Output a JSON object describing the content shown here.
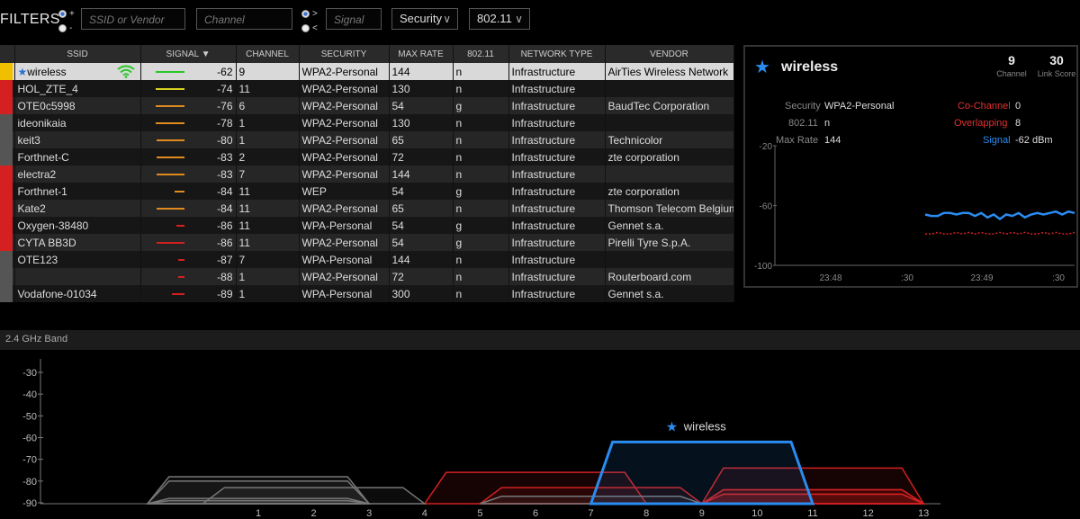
{
  "filters": {
    "title": "FILTERS",
    "plus_label": "+",
    "minus_label": "-",
    "gt_label": ">",
    "lt_label": "<",
    "ssid_placeholder": "SSID or Vendor",
    "channel_placeholder": "Channel",
    "signal_placeholder": "Signal",
    "security_label": "Security",
    "mode_label": "802.11"
  },
  "table": {
    "columns": [
      "SSID",
      "SIGNAL",
      "CHANNEL",
      "SECURITY",
      "MAX RATE",
      "802.11",
      "NETWORK TYPE",
      "VENDOR"
    ],
    "rows": [
      {
        "color": "#f0c000",
        "ssid": "wireless",
        "signal": "-62",
        "channel": "9",
        "security": "WPA2-Personal",
        "maxrate": "144",
        "mode": "n",
        "type": "Infrastructure",
        "vendor": "AirTies Wireless Network",
        "line_color": "#28c828",
        "strength": 0.9
      },
      {
        "color": "#d42020",
        "ssid": "HOL_ZTE_4",
        "signal": "-74",
        "channel": "11",
        "security": "WPA2-Personal",
        "maxrate": "130",
        "mode": "n",
        "type": "Infrastructure",
        "vendor": "",
        "line_color": "#d8d020",
        "strength": 0.9
      },
      {
        "color": "#d42020",
        "ssid": "OTE0c5998",
        "signal": "-76",
        "channel": "6",
        "security": "WPA2-Personal",
        "maxrate": "54",
        "mode": "g",
        "type": "Infrastructure",
        "vendor": "BaudTec Corporation",
        "line_color": "#e08a20",
        "strength": 0.9
      },
      {
        "color": "#555555",
        "ssid": "ideonikaia",
        "signal": "-78",
        "channel": "1",
        "security": "WPA2-Personal",
        "maxrate": "130",
        "mode": "n",
        "type": "Infrastructure",
        "vendor": "",
        "line_color": "#e08a20",
        "strength": 0.9
      },
      {
        "color": "#555555",
        "ssid": "keit3",
        "signal": "-80",
        "channel": "1",
        "security": "WPA2-Personal",
        "maxrate": "65",
        "mode": "n",
        "type": "Infrastructure",
        "vendor": "Technicolor",
        "line_color": "#e08a20",
        "strength": 0.85
      },
      {
        "color": "#555555",
        "ssid": "Forthnet-C",
        "signal": "-83",
        "channel": "2",
        "security": "WPA2-Personal",
        "maxrate": "72",
        "mode": "n",
        "type": "Infrastructure",
        "vendor": "zte corporation",
        "line_color": "#e08a20",
        "strength": 0.85
      },
      {
        "color": "#d42020",
        "ssid": "electra2",
        "signal": "-83",
        "channel": "7",
        "security": "WPA2-Personal",
        "maxrate": "144",
        "mode": "n",
        "type": "Infrastructure",
        "vendor": "",
        "line_color": "#e08a20",
        "strength": 0.85
      },
      {
        "color": "#d42020",
        "ssid": "Forthnet-1",
        "signal": "-84",
        "channel": "11",
        "security": "WEP",
        "maxrate": "54",
        "mode": "g",
        "type": "Infrastructure",
        "vendor": "zte corporation",
        "line_color": "#e08a20",
        "strength": 0.3
      },
      {
        "color": "#d42020",
        "ssid": "Kate2",
        "signal": "-84",
        "channel": "11",
        "security": "WPA2-Personal",
        "maxrate": "65",
        "mode": "n",
        "type": "Infrastructure",
        "vendor": "Thomson Telecom Belgium",
        "line_color": "#e08a20",
        "strength": 0.85
      },
      {
        "color": "#d42020",
        "ssid": "Oxygen-38480",
        "signal": "-86",
        "channel": "11",
        "security": "WPA-Personal",
        "maxrate": "54",
        "mode": "g",
        "type": "Infrastructure",
        "vendor": "Gennet s.a.",
        "line_color": "#d42020",
        "strength": 0.25
      },
      {
        "color": "#d42020",
        "ssid": "CYTA BB3D",
        "signal": "-86",
        "channel": "11",
        "security": "WPA2-Personal",
        "maxrate": "54",
        "mode": "g",
        "type": "Infrastructure",
        "vendor": "Pirelli Tyre S.p.A.",
        "line_color": "#d42020",
        "strength": 0.85
      },
      {
        "color": "#555555",
        "ssid": "OTE123",
        "signal": "-87",
        "channel": "7",
        "security": "WPA-Personal",
        "maxrate": "144",
        "mode": "n",
        "type": "Infrastructure",
        "vendor": "",
        "line_color": "#d42020",
        "strength": 0.2
      },
      {
        "color": "#555555",
        "ssid": "",
        "signal": "-88",
        "channel": "1",
        "security": "WPA2-Personal",
        "maxrate": "72",
        "mode": "n",
        "type": "Infrastructure",
        "vendor": "Routerboard.com",
        "line_color": "#d42020",
        "strength": 0.2
      },
      {
        "color": "#555555",
        "ssid": "Vodafone-01034",
        "signal": "-89",
        "channel": "1",
        "security": "WPA-Personal",
        "maxrate": "300",
        "mode": "n",
        "type": "Infrastructure",
        "vendor": "Gennet s.a.",
        "line_color": "#d42020",
        "strength": 0.4
      }
    ]
  },
  "detail": {
    "name": "wireless",
    "channel_value": "9",
    "channel_label": "Channel",
    "score_value": "30",
    "score_label": "Link Score",
    "security_label": "Security",
    "security_value": "WPA2-Personal",
    "mode_label": "802.11",
    "mode_value": "n",
    "maxrate_label": "Max Rate",
    "maxrate_value": "144",
    "cochannel_label": "Co-Channel",
    "cochannel_value": "0",
    "overlap_label": "Overlapping",
    "overlap_value": "8",
    "signal_label": "Signal",
    "signal_value": "-62 dBm",
    "graph": {
      "y_ticks": [
        "-20",
        "-60",
        "-100"
      ],
      "x_ticks": [
        "23:48",
        ":30",
        "23:49",
        ":30"
      ],
      "signal_series": [
        -66,
        -67,
        -67,
        -65,
        -65,
        -66,
        -65,
        -65,
        -67,
        -65,
        -68,
        -66,
        -69,
        -66,
        -67,
        -65,
        -68,
        -66,
        -65,
        -66,
        -65,
        -64,
        -66,
        -64,
        -65
      ],
      "noise_series": [
        -79,
        -79,
        -78,
        -79,
        -79,
        -78,
        -79,
        -78,
        -79,
        -78,
        -79,
        -79,
        -78,
        -79,
        -78,
        -79,
        -78,
        -79,
        -79,
        -78,
        -79,
        -78,
        -79,
        -79,
        -78
      ]
    }
  },
  "band": {
    "title": "2.4 GHz Band",
    "y_ticks": [
      "-30",
      "-40",
      "-50",
      "-60",
      "-70",
      "-80",
      "-90"
    ],
    "x_ticks": [
      "1",
      "2",
      "3",
      "4",
      "5",
      "6",
      "7",
      "8",
      "9",
      "10",
      "11",
      "12",
      "13"
    ],
    "highlight_label": "wireless",
    "networks": [
      {
        "channel": 9,
        "signal": -62,
        "color": "#2a8cf0",
        "selected": true
      },
      {
        "channel": 11,
        "signal": -74,
        "color": "#d42020"
      },
      {
        "channel": 6,
        "signal": -76,
        "color": "#d42020"
      },
      {
        "channel": 1,
        "signal": -78,
        "color": "#777777"
      },
      {
        "channel": 1,
        "signal": -80,
        "color": "#777777"
      },
      {
        "channel": 2,
        "signal": -83,
        "color": "#777777"
      },
      {
        "channel": 7,
        "signal": -83,
        "color": "#d42020"
      },
      {
        "channel": 11,
        "signal": -84,
        "color": "#d42020"
      },
      {
        "channel": 11,
        "signal": -84,
        "color": "#d42020"
      },
      {
        "channel": 11,
        "signal": -86,
        "color": "#d42020"
      },
      {
        "channel": 11,
        "signal": -86,
        "color": "#d42020"
      },
      {
        "channel": 7,
        "signal": -87,
        "color": "#777777"
      },
      {
        "channel": 1,
        "signal": -88,
        "color": "#777777"
      },
      {
        "channel": 1,
        "signal": -89,
        "color": "#777777"
      }
    ]
  },
  "colors": {
    "accent": "#2a8cf0",
    "danger": "#d42020"
  }
}
